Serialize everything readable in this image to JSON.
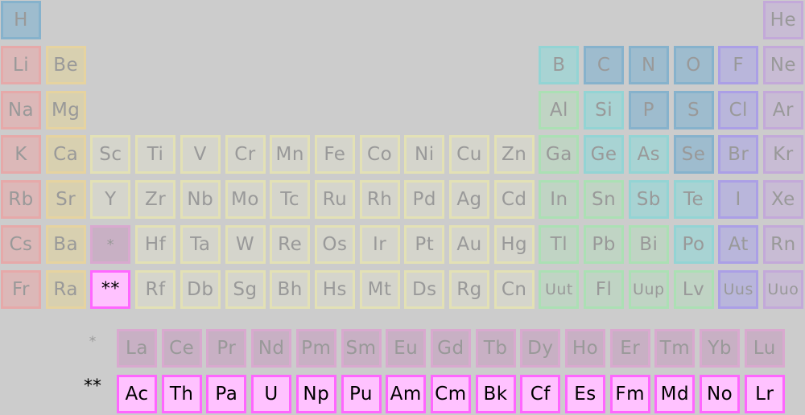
{
  "categories": {
    "alkali": {
      "fill": "#dcb8b8",
      "border": "#e6a9a9"
    },
    "alkaline": {
      "fill": "#d8d0b0",
      "border": "#e6d3a0"
    },
    "transition": {
      "fill": "#d5d5cc",
      "border": "#e3e1b5"
    },
    "post": {
      "fill": "#c0d4c4",
      "border": "#abe0b4"
    },
    "metalloid": {
      "fill": "#a8d3d3",
      "border": "#93d4d4"
    },
    "nonmetal": {
      "fill": "#9ebcce",
      "border": "#86b2cc"
    },
    "halogen": {
      "fill": "#b9b6db",
      "border": "#ab9fe6"
    },
    "noble": {
      "fill": "#c8bcd4",
      "border": "#c3a9d9"
    },
    "lanthanide": {
      "fill": "#c8b0c4",
      "border": "#d9a9cf"
    },
    "actinide": {
      "fill": "#ffc2ff",
      "border": "#ff66ff"
    }
  },
  "elements": [
    {
      "s": "H",
      "r": 1,
      "c": 1,
      "cat": "nonmetal"
    },
    {
      "s": "He",
      "r": 1,
      "c": 18,
      "cat": "noble"
    },
    {
      "s": "Li",
      "r": 2,
      "c": 1,
      "cat": "alkali"
    },
    {
      "s": "Be",
      "r": 2,
      "c": 2,
      "cat": "alkaline"
    },
    {
      "s": "B",
      "r": 2,
      "c": 13,
      "cat": "metalloid"
    },
    {
      "s": "C",
      "r": 2,
      "c": 14,
      "cat": "nonmetal"
    },
    {
      "s": "N",
      "r": 2,
      "c": 15,
      "cat": "nonmetal"
    },
    {
      "s": "O",
      "r": 2,
      "c": 16,
      "cat": "nonmetal"
    },
    {
      "s": "F",
      "r": 2,
      "c": 17,
      "cat": "halogen"
    },
    {
      "s": "Ne",
      "r": 2,
      "c": 18,
      "cat": "noble"
    },
    {
      "s": "Na",
      "r": 3,
      "c": 1,
      "cat": "alkali"
    },
    {
      "s": "Mg",
      "r": 3,
      "c": 2,
      "cat": "alkaline"
    },
    {
      "s": "Al",
      "r": 3,
      "c": 13,
      "cat": "post"
    },
    {
      "s": "Si",
      "r": 3,
      "c": 14,
      "cat": "metalloid"
    },
    {
      "s": "P",
      "r": 3,
      "c": 15,
      "cat": "nonmetal"
    },
    {
      "s": "S",
      "r": 3,
      "c": 16,
      "cat": "nonmetal"
    },
    {
      "s": "Cl",
      "r": 3,
      "c": 17,
      "cat": "halogen"
    },
    {
      "s": "Ar",
      "r": 3,
      "c": 18,
      "cat": "noble"
    },
    {
      "s": "K",
      "r": 4,
      "c": 1,
      "cat": "alkali"
    },
    {
      "s": "Ca",
      "r": 4,
      "c": 2,
      "cat": "alkaline"
    },
    {
      "s": "Sc",
      "r": 4,
      "c": 3,
      "cat": "transition"
    },
    {
      "s": "Ti",
      "r": 4,
      "c": 4,
      "cat": "transition"
    },
    {
      "s": "V",
      "r": 4,
      "c": 5,
      "cat": "transition"
    },
    {
      "s": "Cr",
      "r": 4,
      "c": 6,
      "cat": "transition"
    },
    {
      "s": "Mn",
      "r": 4,
      "c": 7,
      "cat": "transition"
    },
    {
      "s": "Fe",
      "r": 4,
      "c": 8,
      "cat": "transition"
    },
    {
      "s": "Co",
      "r": 4,
      "c": 9,
      "cat": "transition"
    },
    {
      "s": "Ni",
      "r": 4,
      "c": 10,
      "cat": "transition"
    },
    {
      "s": "Cu",
      "r": 4,
      "c": 11,
      "cat": "transition"
    },
    {
      "s": "Zn",
      "r": 4,
      "c": 12,
      "cat": "transition"
    },
    {
      "s": "Ga",
      "r": 4,
      "c": 13,
      "cat": "post"
    },
    {
      "s": "Ge",
      "r": 4,
      "c": 14,
      "cat": "metalloid"
    },
    {
      "s": "As",
      "r": 4,
      "c": 15,
      "cat": "metalloid"
    },
    {
      "s": "Se",
      "r": 4,
      "c": 16,
      "cat": "nonmetal"
    },
    {
      "s": "Br",
      "r": 4,
      "c": 17,
      "cat": "halogen"
    },
    {
      "s": "Kr",
      "r": 4,
      "c": 18,
      "cat": "noble"
    },
    {
      "s": "Rb",
      "r": 5,
      "c": 1,
      "cat": "alkali"
    },
    {
      "s": "Sr",
      "r": 5,
      "c": 2,
      "cat": "alkaline"
    },
    {
      "s": "Y",
      "r": 5,
      "c": 3,
      "cat": "transition"
    },
    {
      "s": "Zr",
      "r": 5,
      "c": 4,
      "cat": "transition"
    },
    {
      "s": "Nb",
      "r": 5,
      "c": 5,
      "cat": "transition"
    },
    {
      "s": "Mo",
      "r": 5,
      "c": 6,
      "cat": "transition"
    },
    {
      "s": "Tc",
      "r": 5,
      "c": 7,
      "cat": "transition"
    },
    {
      "s": "Ru",
      "r": 5,
      "c": 8,
      "cat": "transition"
    },
    {
      "s": "Rh",
      "r": 5,
      "c": 9,
      "cat": "transition"
    },
    {
      "s": "Pd",
      "r": 5,
      "c": 10,
      "cat": "transition"
    },
    {
      "s": "Ag",
      "r": 5,
      "c": 11,
      "cat": "transition"
    },
    {
      "s": "Cd",
      "r": 5,
      "c": 12,
      "cat": "transition"
    },
    {
      "s": "In",
      "r": 5,
      "c": 13,
      "cat": "post"
    },
    {
      "s": "Sn",
      "r": 5,
      "c": 14,
      "cat": "post"
    },
    {
      "s": "Sb",
      "r": 5,
      "c": 15,
      "cat": "metalloid"
    },
    {
      "s": "Te",
      "r": 5,
      "c": 16,
      "cat": "metalloid"
    },
    {
      "s": "I",
      "r": 5,
      "c": 17,
      "cat": "halogen"
    },
    {
      "s": "Xe",
      "r": 5,
      "c": 18,
      "cat": "noble"
    },
    {
      "s": "Cs",
      "r": 6,
      "c": 1,
      "cat": "alkali"
    },
    {
      "s": "Ba",
      "r": 6,
      "c": 2,
      "cat": "alkaline"
    },
    {
      "s": "Hf",
      "r": 6,
      "c": 4,
      "cat": "transition"
    },
    {
      "s": "Ta",
      "r": 6,
      "c": 5,
      "cat": "transition"
    },
    {
      "s": "W",
      "r": 6,
      "c": 6,
      "cat": "transition"
    },
    {
      "s": "Re",
      "r": 6,
      "c": 7,
      "cat": "transition"
    },
    {
      "s": "Os",
      "r": 6,
      "c": 8,
      "cat": "transition"
    },
    {
      "s": "Ir",
      "r": 6,
      "c": 9,
      "cat": "transition"
    },
    {
      "s": "Pt",
      "r": 6,
      "c": 10,
      "cat": "transition"
    },
    {
      "s": "Au",
      "r": 6,
      "c": 11,
      "cat": "transition"
    },
    {
      "s": "Hg",
      "r": 6,
      "c": 12,
      "cat": "transition"
    },
    {
      "s": "Tl",
      "r": 6,
      "c": 13,
      "cat": "post"
    },
    {
      "s": "Pb",
      "r": 6,
      "c": 14,
      "cat": "post"
    },
    {
      "s": "Bi",
      "r": 6,
      "c": 15,
      "cat": "post"
    },
    {
      "s": "Po",
      "r": 6,
      "c": 16,
      "cat": "metalloid"
    },
    {
      "s": "At",
      "r": 6,
      "c": 17,
      "cat": "halogen"
    },
    {
      "s": "Rn",
      "r": 6,
      "c": 18,
      "cat": "noble"
    },
    {
      "s": "Fr",
      "r": 7,
      "c": 1,
      "cat": "alkali"
    },
    {
      "s": "Ra",
      "r": 7,
      "c": 2,
      "cat": "alkaline"
    },
    {
      "s": "Rf",
      "r": 7,
      "c": 4,
      "cat": "transition"
    },
    {
      "s": "Db",
      "r": 7,
      "c": 5,
      "cat": "transition"
    },
    {
      "s": "Sg",
      "r": 7,
      "c": 6,
      "cat": "transition"
    },
    {
      "s": "Bh",
      "r": 7,
      "c": 7,
      "cat": "transition"
    },
    {
      "s": "Hs",
      "r": 7,
      "c": 8,
      "cat": "transition"
    },
    {
      "s": "Mt",
      "r": 7,
      "c": 9,
      "cat": "transition"
    },
    {
      "s": "Ds",
      "r": 7,
      "c": 10,
      "cat": "transition"
    },
    {
      "s": "Rg",
      "r": 7,
      "c": 11,
      "cat": "transition"
    },
    {
      "s": "Cn",
      "r": 7,
      "c": 12,
      "cat": "transition"
    },
    {
      "s": "Uut",
      "r": 7,
      "c": 13,
      "cat": "post",
      "small": true
    },
    {
      "s": "Fl",
      "r": 7,
      "c": 14,
      "cat": "post"
    },
    {
      "s": "Uup",
      "r": 7,
      "c": 15,
      "cat": "post",
      "small": true
    },
    {
      "s": "Lv",
      "r": 7,
      "c": 16,
      "cat": "post"
    },
    {
      "s": "Uus",
      "r": 7,
      "c": 17,
      "cat": "halogen",
      "small": true
    },
    {
      "s": "Uuo",
      "r": 7,
      "c": 18,
      "cat": "noble",
      "small": true
    }
  ],
  "placeholders": [
    {
      "s": "*",
      "r": 6,
      "c": 3,
      "cat": "lanthanide",
      "small": true
    },
    {
      "s": "**",
      "r": 7,
      "c": 3,
      "cat": "actinide",
      "hl": true
    }
  ],
  "lanthanides": {
    "marker": "*",
    "symbols": [
      "La",
      "Ce",
      "Pr",
      "Nd",
      "Pm",
      "Sm",
      "Eu",
      "Gd",
      "Tb",
      "Dy",
      "Ho",
      "Er",
      "Tm",
      "Yb",
      "Lu"
    ]
  },
  "actinides": {
    "marker": "**",
    "highlighted": true,
    "symbols": [
      "Ac",
      "Th",
      "Pa",
      "U",
      "Np",
      "Pu",
      "Am",
      "Cm",
      "Bk",
      "Cf",
      "Es",
      "Fm",
      "Md",
      "No",
      "Lr"
    ]
  }
}
